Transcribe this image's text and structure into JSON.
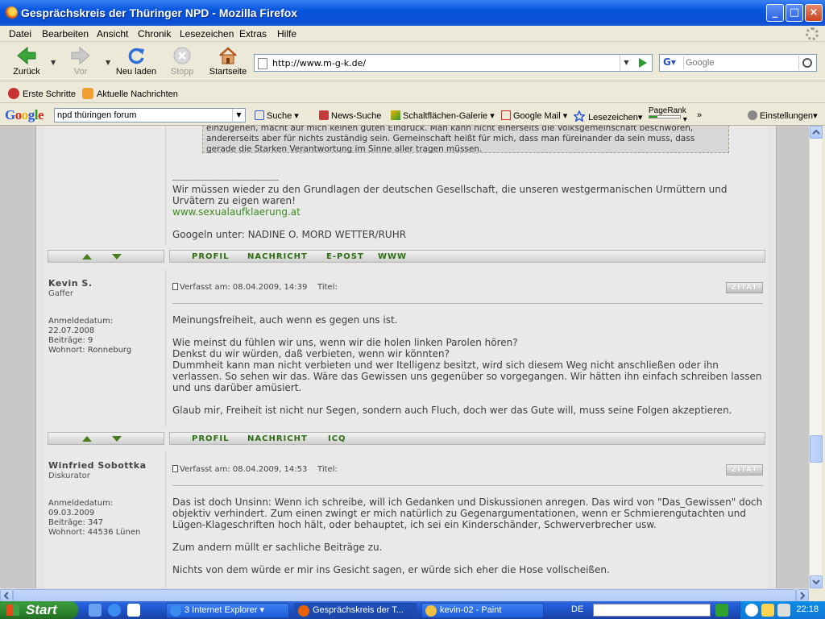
{
  "window": {
    "title": "Gesprächskreis der Thüringer NPD - Mozilla Firefox"
  },
  "menu": [
    "Datei",
    "Bearbeiten",
    "Ansicht",
    "Chronik",
    "Lesezeichen",
    "Extras",
    "Hilfe"
  ],
  "nav": {
    "back": "Zurück",
    "forward": "Vor",
    "reload": "Neu laden",
    "stop": "Stopp",
    "home": "Startseite",
    "url": "http://www.m-g-k.de/",
    "search_placeholder": "Google"
  },
  "bookmarks": [
    "Erste Schritte",
    "Aktuelle Nachrichten"
  ],
  "google_toolbar": {
    "logo": "Google",
    "query": "npd thüringen forum",
    "items": [
      "Suche",
      "News-Suche",
      "Schaltflächen-Galerie",
      "Google Mail",
      "Lesezeichen",
      "PageRank",
      "»",
      "Einstellungen"
    ]
  },
  "forum": {
    "quote_text": "einzugehen, macht auf mich keinen guten Eindruck. Man kann nicht einerseits die Volksgemeinschaft beschwören, andererseits aber für nichts zuständig sein. Gemeinschaft heißt für mich, dass man füreinander da sein muss, dass gerade die Starken Verantwortung im Sinne aller tragen müssen.",
    "signature_line": "______________________",
    "signature_text": "Wir müssen wieder zu den Grundlagen der deutschen Gesellschaft, die unseren westgermanischen Urmüttern und Urvätern zu eigen waren!",
    "signature_link": "www.sexualaufklaerung.at",
    "signature_extra": "Googeln unter: NADINE O. MORD WETTER/RUHR",
    "actions_1": [
      "PROFIL",
      "NACHRICHT",
      "E-POST",
      "WWW"
    ],
    "actions_2": [
      "PROFIL",
      "NACHRICHT",
      "ICQ"
    ],
    "zitat_label": "ZITAT",
    "posts": [
      {
        "author": "Kevin S.",
        "rank": "Gaffer",
        "meta": [
          "Anmeldedatum:",
          "22.07.2008",
          "Beiträge: 9",
          "Wohnort: Ronneburg"
        ],
        "header": "Verfasst am: 08.04.2009, 14:39    Titel:",
        "body": "Meinungsfreiheit, auch wenn es gegen uns ist.\n\nWie meinst du fühlen wir uns, wenn wir die holen linken Parolen hören?\nDenkst du wir würden, daß verbieten, wenn wir könnten?\nDummheit kann man nicht verbieten und wer Itelligenz besitzt, wird sich diesem Weg nicht anschließen oder ihn verlassen. So sehen wir das. Wäre das Gewissen uns gegenüber so vorgegangen. Wir hätten ihn einfach schreiben lassen und uns darüber amüsiert.\n\nGlaub mir, Freiheit ist nicht nur Segen, sondern auch Fluch, doch wer das Gute will, muss seine Folgen akzeptieren."
      },
      {
        "author": "Winfried Sobottka",
        "rank": "Diskurator",
        "meta": [
          "Anmeldedatum:",
          "09.03.2009",
          "Beiträge: 347",
          "Wohnort: 44536 Lünen"
        ],
        "header": "Verfasst am: 08.04.2009, 14:53    Titel:",
        "body": "Das ist doch Unsinn: Wenn ich schreibe, will ich Gedanken und Diskussionen anregen. Das wird von \"Das_Gewissen\" doch objektiv verhindert. Zum einen zwingt er mich natürlich zu Gegenargumentationen, wenn er Schmierengutachten und Lügen-Klageschriften hoch hält, oder behauptet, ich sei ein Kinderschänder, Schwerverbrecher usw.\n\nZum andern müllt er sachliche Beiträge zu.\n\nNichts von dem würde er mir ins Gesicht sagen, er würde sich eher die Hose vollscheißen."
      }
    ]
  },
  "taskbar": {
    "start": "Start",
    "tasks": [
      "3 Internet Explorer",
      "Gesprächskreis der T...",
      "kevin-02 - Paint"
    ],
    "lang": "DE",
    "clock": "22:18"
  }
}
